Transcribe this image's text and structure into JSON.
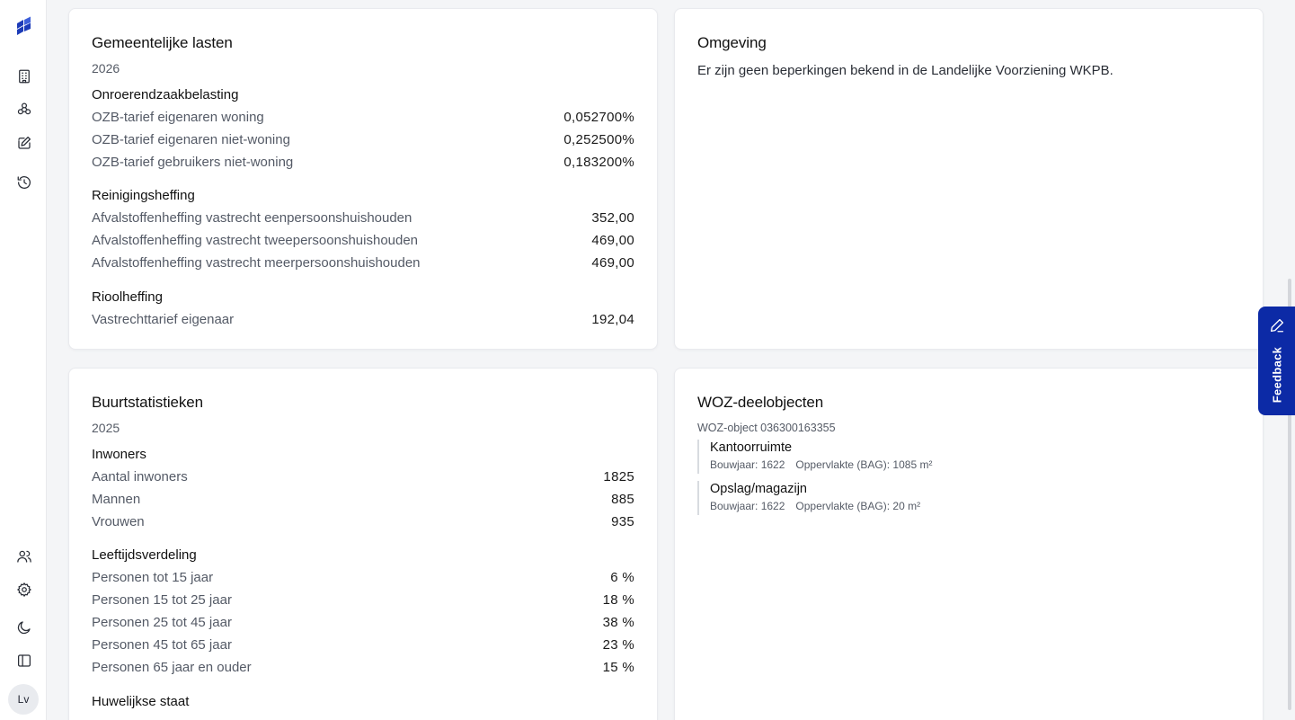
{
  "colors": {
    "accent": "#0c2aa6",
    "card": "#ffffff",
    "background": "#f4f5f7"
  },
  "sidebar": {
    "logo_icon": "stacked-tiles-logo",
    "top_items": [
      {
        "icon": "building-icon"
      },
      {
        "icon": "network-icon"
      },
      {
        "icon": "edit-icon"
      },
      {
        "icon": "history-icon"
      }
    ],
    "bottom_items": [
      {
        "icon": "users-icon"
      },
      {
        "icon": "gear-icon"
      },
      {
        "icon": "moon-icon"
      },
      {
        "icon": "sidebar-toggle-icon"
      }
    ],
    "avatar_initials": "Lv"
  },
  "gemeentelijke_lasten": {
    "title": "Gemeentelijke lasten",
    "year": "2026",
    "sections": [
      {
        "heading": "Onroerendzaakbelasting",
        "rows": [
          {
            "label": "OZB-tarief eigenaren woning",
            "value": "0,052700%"
          },
          {
            "label": "OZB-tarief eigenaren niet-woning",
            "value": "0,252500%"
          },
          {
            "label": "OZB-tarief gebruikers niet-woning",
            "value": "0,183200%"
          }
        ]
      },
      {
        "heading": "Reinigingsheffing",
        "rows": [
          {
            "label": "Afvalstoffenheffing vastrecht eenpersoonshuishouden",
            "value": "352,00"
          },
          {
            "label": "Afvalstoffenheffing vastrecht tweepersoonshuishouden",
            "value": "469,00"
          },
          {
            "label": "Afvalstoffenheffing vastrecht meerpersoonshuishouden",
            "value": "469,00"
          }
        ]
      },
      {
        "heading": "Rioolheffing",
        "rows": [
          {
            "label": "Vastrechttarief eigenaar",
            "value": "192,04"
          }
        ]
      }
    ]
  },
  "omgeving": {
    "title": "Omgeving",
    "text": "Er zijn geen beperkingen bekend in de Landelijke Voorziening WKPB."
  },
  "buurtstatistieken": {
    "title": "Buurtstatistieken",
    "year": "2025",
    "sections": [
      {
        "heading": "Inwoners",
        "rows": [
          {
            "label": "Aantal inwoners",
            "value": "1825"
          },
          {
            "label": "Mannen",
            "value": "885"
          },
          {
            "label": "Vrouwen",
            "value": "935"
          }
        ]
      },
      {
        "heading": "Leeftijdsverdeling",
        "rows": [
          {
            "label": "Personen tot 15 jaar",
            "value": "6 %"
          },
          {
            "label": "Personen 15 tot 25 jaar",
            "value": "18 %"
          },
          {
            "label": "Personen 25 tot 45 jaar",
            "value": "38 %"
          },
          {
            "label": "Personen 45 tot 65 jaar",
            "value": "23 %"
          },
          {
            "label": "Personen 65 jaar en ouder",
            "value": "15 %"
          }
        ]
      },
      {
        "heading": "Huwelijkse staat",
        "rows": []
      }
    ]
  },
  "woz": {
    "title": "WOZ-deelobjecten",
    "object_label": "WOZ-object 036300163355",
    "items": [
      {
        "name": "Kantoorruimte",
        "bouwjaar": "Bouwjaar: 1622",
        "oppervlakte": "Oppervlakte (BAG): 1085 m²"
      },
      {
        "name": "Opslag/magazijn",
        "bouwjaar": "Bouwjaar: 1622",
        "oppervlakte": "Oppervlakte (BAG): 20 m²"
      }
    ]
  },
  "feedback": {
    "label": "Feedback",
    "icon": "pencil-icon"
  }
}
